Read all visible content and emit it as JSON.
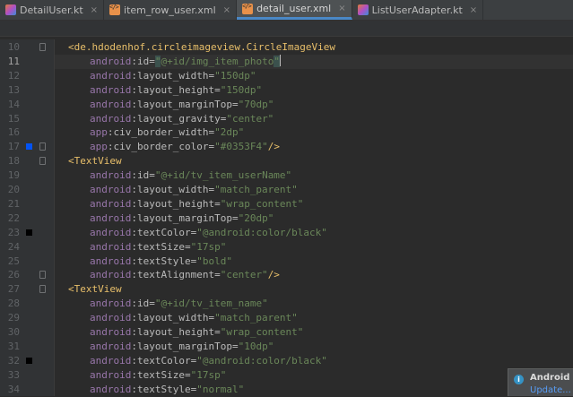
{
  "tabs": [
    {
      "label": "DetailUser.kt",
      "icon": "kotlin-file-icon",
      "active": false
    },
    {
      "label": "item_row_user.xml",
      "icon": "xml-file-icon",
      "active": false
    },
    {
      "label": "detail_user.xml",
      "icon": "xml-file-icon",
      "active": true
    },
    {
      "label": "ListUserAdapter.kt",
      "icon": "kotlin-file-icon",
      "active": false
    }
  ],
  "editor": {
    "current_line": 11,
    "lines": [
      {
        "num": "10",
        "segments": [
          {
            "t": "<de.hdodenhof.circleimageview.CircleImageView",
            "c": "tag"
          }
        ],
        "indent": 0
      },
      {
        "num": "11",
        "segments": [
          {
            "t": "android",
            "c": "ns"
          },
          {
            "t": ":id=",
            "c": "attr"
          },
          {
            "t": "\"",
            "c": "hl"
          },
          {
            "t": "@+id/img_item_photo",
            "c": "val"
          },
          {
            "t": "\"",
            "c": "hl"
          }
        ],
        "indent": 1
      },
      {
        "num": "12",
        "segments": [
          {
            "t": "android",
            "c": "ns"
          },
          {
            "t": ":layout_width=",
            "c": "attr"
          },
          {
            "t": "\"150dp\"",
            "c": "val"
          }
        ],
        "indent": 1
      },
      {
        "num": "13",
        "segments": [
          {
            "t": "android",
            "c": "ns"
          },
          {
            "t": ":layout_height=",
            "c": "attr"
          },
          {
            "t": "\"150dp\"",
            "c": "val"
          }
        ],
        "indent": 1
      },
      {
        "num": "14",
        "segments": [
          {
            "t": "android",
            "c": "ns"
          },
          {
            "t": ":layout_marginTop=",
            "c": "attr"
          },
          {
            "t": "\"70dp\"",
            "c": "val"
          }
        ],
        "indent": 1
      },
      {
        "num": "15",
        "segments": [
          {
            "t": "android",
            "c": "ns"
          },
          {
            "t": ":layout_gravity=",
            "c": "attr"
          },
          {
            "t": "\"center\"",
            "c": "val"
          }
        ],
        "indent": 1
      },
      {
        "num": "16",
        "segments": [
          {
            "t": "app",
            "c": "ns"
          },
          {
            "t": ":civ_border_width=",
            "c": "attr"
          },
          {
            "t": "\"2dp\"",
            "c": "val"
          }
        ],
        "indent": 1
      },
      {
        "num": "17",
        "segments": [
          {
            "t": "app",
            "c": "ns"
          },
          {
            "t": ":civ_border_color=",
            "c": "attr"
          },
          {
            "t": "\"#0353F4\"",
            "c": "val"
          },
          {
            "t": "/>",
            "c": "tag"
          }
        ],
        "indent": 1,
        "marker": "#0353F4"
      },
      {
        "num": "18",
        "segments": [
          {
            "t": "<TextView",
            "c": "tag"
          }
        ],
        "indent": 0
      },
      {
        "num": "19",
        "segments": [
          {
            "t": "android",
            "c": "ns"
          },
          {
            "t": ":id=",
            "c": "attr"
          },
          {
            "t": "\"@+id/tv_item_userName\"",
            "c": "val"
          }
        ],
        "indent": 1
      },
      {
        "num": "20",
        "segments": [
          {
            "t": "android",
            "c": "ns"
          },
          {
            "t": ":layout_width=",
            "c": "attr"
          },
          {
            "t": "\"match_parent\"",
            "c": "val"
          }
        ],
        "indent": 1
      },
      {
        "num": "21",
        "segments": [
          {
            "t": "android",
            "c": "ns"
          },
          {
            "t": ":layout_height=",
            "c": "attr"
          },
          {
            "t": "\"wrap_content\"",
            "c": "val"
          }
        ],
        "indent": 1
      },
      {
        "num": "22",
        "segments": [
          {
            "t": "android",
            "c": "ns"
          },
          {
            "t": ":layout_marginTop=",
            "c": "attr"
          },
          {
            "t": "\"20dp\"",
            "c": "val"
          }
        ],
        "indent": 1
      },
      {
        "num": "23",
        "segments": [
          {
            "t": "android",
            "c": "ns"
          },
          {
            "t": ":textColor=",
            "c": "attr"
          },
          {
            "t": "\"@android:color/black\"",
            "c": "val"
          }
        ],
        "indent": 1,
        "marker": "#000000"
      },
      {
        "num": "24",
        "segments": [
          {
            "t": "android",
            "c": "ns"
          },
          {
            "t": ":textSize=",
            "c": "attr"
          },
          {
            "t": "\"17sp\"",
            "c": "val"
          }
        ],
        "indent": 1
      },
      {
        "num": "25",
        "segments": [
          {
            "t": "android",
            "c": "ns"
          },
          {
            "t": ":textStyle=",
            "c": "attr"
          },
          {
            "t": "\"bold\"",
            "c": "val"
          }
        ],
        "indent": 1
      },
      {
        "num": "26",
        "segments": [
          {
            "t": "android",
            "c": "ns"
          },
          {
            "t": ":textAlignment=",
            "c": "attr"
          },
          {
            "t": "\"center\"",
            "c": "val"
          },
          {
            "t": "/>",
            "c": "tag"
          }
        ],
        "indent": 1
      },
      {
        "num": "27",
        "segments": [
          {
            "t": "<TextView",
            "c": "tag"
          }
        ],
        "indent": 0
      },
      {
        "num": "28",
        "segments": [
          {
            "t": "android",
            "c": "ns"
          },
          {
            "t": ":id=",
            "c": "attr"
          },
          {
            "t": "\"@+id/tv_item_name\"",
            "c": "val"
          }
        ],
        "indent": 1
      },
      {
        "num": "29",
        "segments": [
          {
            "t": "android",
            "c": "ns"
          },
          {
            "t": ":layout_width=",
            "c": "attr"
          },
          {
            "t": "\"match_parent\"",
            "c": "val"
          }
        ],
        "indent": 1
      },
      {
        "num": "30",
        "segments": [
          {
            "t": "android",
            "c": "ns"
          },
          {
            "t": ":layout_height=",
            "c": "attr"
          },
          {
            "t": "\"wrap_content\"",
            "c": "val"
          }
        ],
        "indent": 1
      },
      {
        "num": "31",
        "segments": [
          {
            "t": "android",
            "c": "ns"
          },
          {
            "t": ":layout_marginTop=",
            "c": "attr"
          },
          {
            "t": "\"10dp\"",
            "c": "val"
          }
        ],
        "indent": 1
      },
      {
        "num": "32",
        "segments": [
          {
            "t": "android",
            "c": "ns"
          },
          {
            "t": ":textColor=",
            "c": "attr"
          },
          {
            "t": "\"@android:color/black\"",
            "c": "val"
          }
        ],
        "indent": 1,
        "marker": "#000000"
      },
      {
        "num": "33",
        "segments": [
          {
            "t": "android",
            "c": "ns"
          },
          {
            "t": ":textSize=",
            "c": "attr"
          },
          {
            "t": "\"17sp\"",
            "c": "val"
          }
        ],
        "indent": 1
      },
      {
        "num": "34",
        "segments": [
          {
            "t": "android",
            "c": "ns"
          },
          {
            "t": ":textStyle=",
            "c": "attr"
          },
          {
            "t": "\"normal\"",
            "c": "val"
          }
        ],
        "indent": 1
      }
    ]
  },
  "notification": {
    "title": "Android St",
    "link": "Update...",
    "icon": "info-icon"
  },
  "colors": {
    "editor_bg": "#2b2b2b",
    "tag": "#e8bf6a",
    "namespace": "#9876aa",
    "value": "#6a8759",
    "active_tab_underline": "#4a88c7"
  }
}
